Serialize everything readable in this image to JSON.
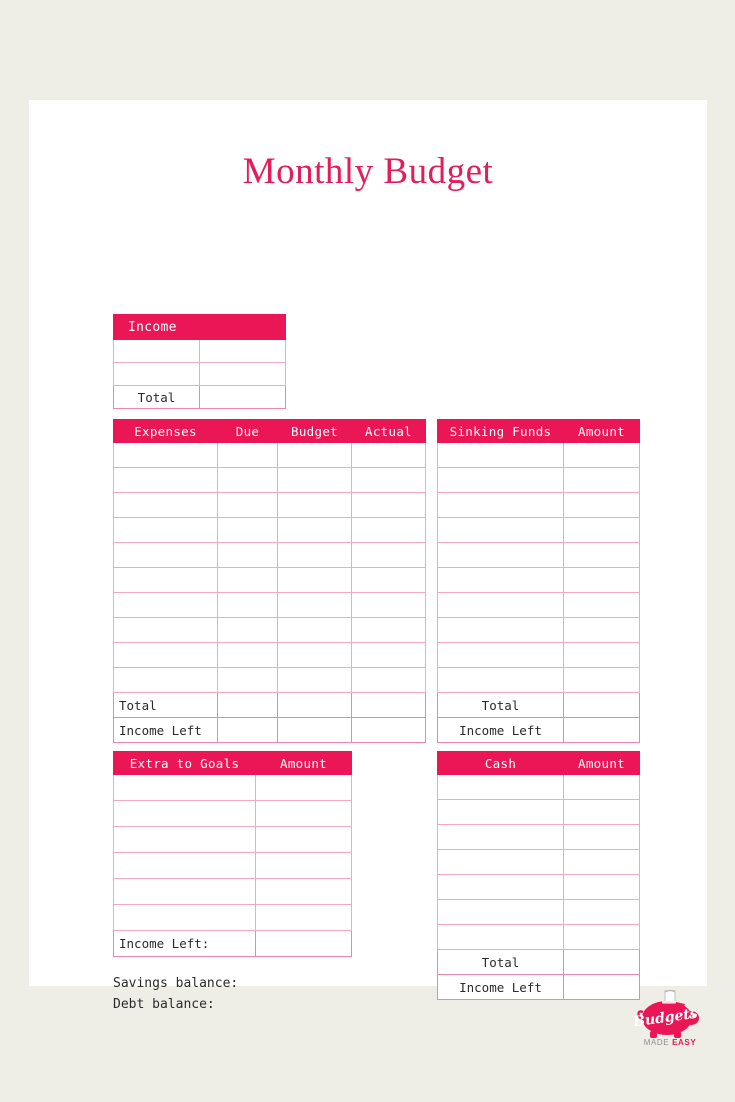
{
  "page": {
    "title": "Monthly Budget",
    "background_color": "#eeeee7",
    "card_color": "#ffffff",
    "accent_color": "#ea1656",
    "grid_color": "#f4a8c6"
  },
  "income_table": {
    "header": "Income",
    "blank_rows": 2,
    "total_label": "Total"
  },
  "expenses_table": {
    "headers": [
      "Expenses",
      "Due",
      "Budget",
      "Actual"
    ],
    "blank_rows": 10,
    "total_label": "Total",
    "income_left_label": "Income Left"
  },
  "sinking_funds_table": {
    "headers": [
      "Sinking Funds",
      "Amount"
    ],
    "blank_rows": 10,
    "total_label": "Total",
    "income_left_label": "Income Left"
  },
  "goals_table": {
    "headers": [
      "Extra to Goals",
      "Amount"
    ],
    "blank_rows": 6,
    "income_left_label": "Income Left:"
  },
  "cash_table": {
    "headers": [
      "Cash",
      "Amount"
    ],
    "blank_rows": 7,
    "total_label": "Total",
    "income_left_label": "Income Left"
  },
  "notes": {
    "savings": "Savings balance:",
    "debt": "Debt balance:"
  },
  "logo": {
    "wordmark": "Budgets",
    "tagline_plain": "MADE ",
    "tagline_accent": "EASY"
  }
}
